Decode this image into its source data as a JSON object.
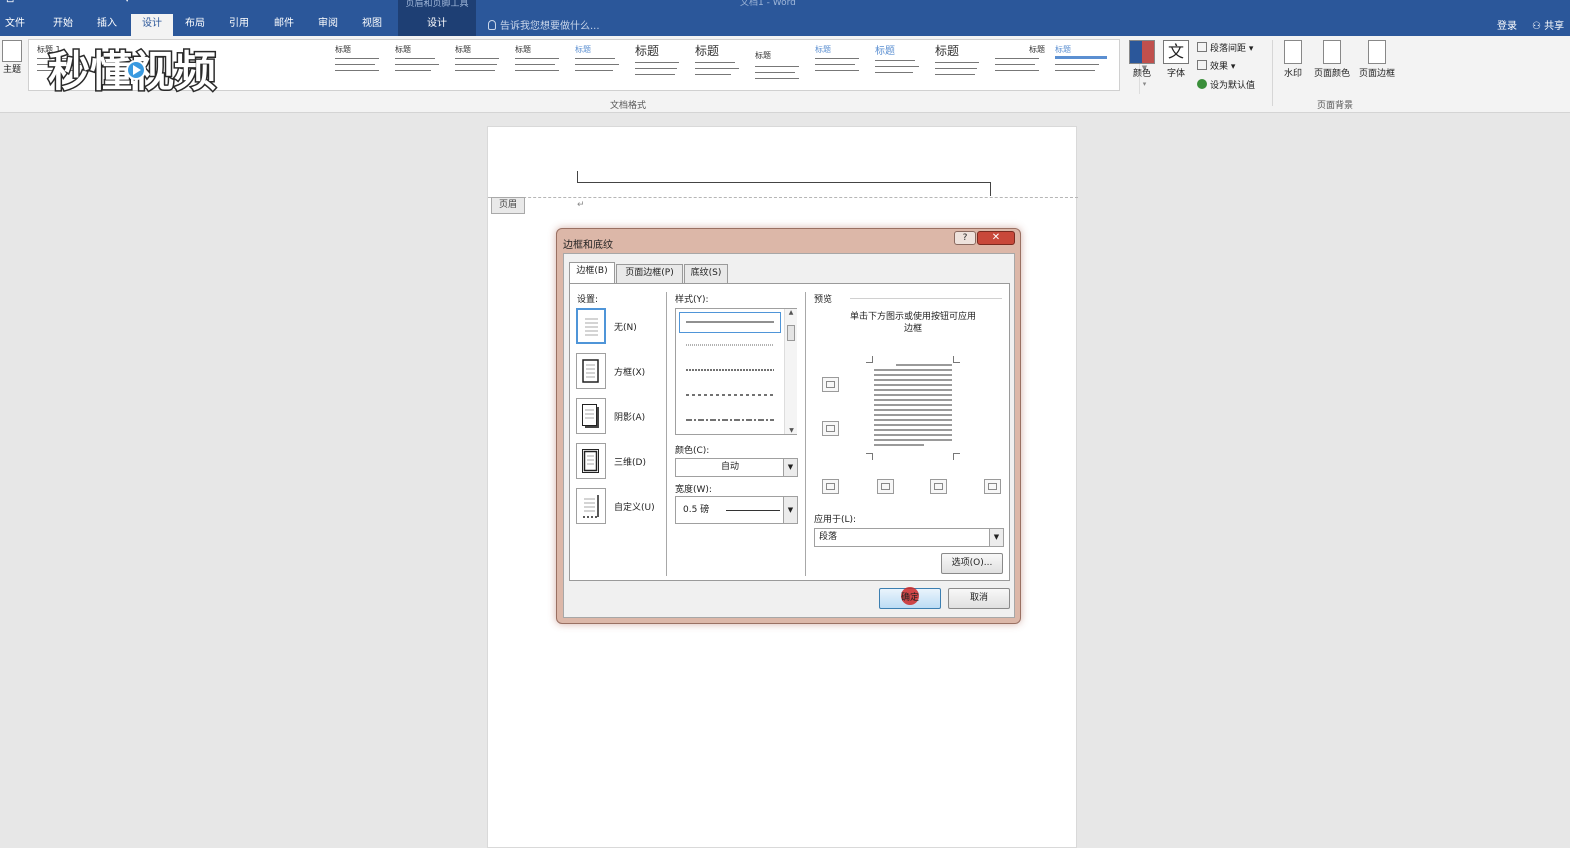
{
  "window": {
    "title": "文档1 - Word",
    "context_group": "页眉和页脚工具"
  },
  "qat": "⊡ ↶ ↷ ▾",
  "tabs": [
    {
      "label": "文件",
      "active": false
    },
    {
      "label": "开始",
      "active": false
    },
    {
      "label": "插入",
      "active": false
    },
    {
      "label": "设计",
      "active": true
    },
    {
      "label": "布局",
      "active": false
    },
    {
      "label": "引用",
      "active": false
    },
    {
      "label": "邮件",
      "active": false
    },
    {
      "label": "审阅",
      "active": false
    },
    {
      "label": "视图",
      "active": false
    }
  ],
  "context_tab": "设计",
  "tell_me": "告诉我您想要做什么...",
  "signin": "登录",
  "share": "共享",
  "ribbon": {
    "theme_label": "主题",
    "group_doc_format": "文档格式",
    "styles": [
      "标题 1",
      "标题",
      "标题",
      "标题",
      "标题",
      "标题",
      "标题",
      "标题",
      "标题",
      "标题",
      "标题",
      "标题",
      "标题",
      "标题",
      "标题",
      "标题",
      "标题"
    ],
    "colors_label": "颜色",
    "fonts_label": "字体",
    "fonts_glyph": "文",
    "para_spacing": "段落间距",
    "effects": "效果",
    "set_default": "设为默认值",
    "watermark": "水印",
    "page_color": "页面颜色",
    "page_borders": "页面边框",
    "group_page_bg": "页面背景"
  },
  "watermark_logo": "秒懂视频",
  "document": {
    "header_tag": "页眉",
    "para_mark": "↵"
  },
  "dialog": {
    "title": "边框和底纹",
    "help": "?",
    "close": "✕",
    "tabs": [
      "边框(B)",
      "页面边框(P)",
      "底纹(S)"
    ],
    "setting_label": "设置:",
    "settings": [
      "无(N)",
      "方框(X)",
      "阴影(A)",
      "三维(D)",
      "自定义(U)"
    ],
    "style_label": "样式(Y):",
    "color_label": "颜色(C):",
    "color_value": "自动",
    "width_label": "宽度(W):",
    "width_value": "0.5 磅",
    "preview_label": "预览",
    "preview_hint": "单击下方图示或使用按钮可应用边框",
    "apply_label": "应用于(L):",
    "apply_value": "段落",
    "options": "选项(O)...",
    "ok": "确定",
    "cancel": "取消"
  },
  "colors": {
    "accent": "#2b579a",
    "dialog_frame": "#dcb7a8",
    "selection": "#4f95d8"
  }
}
